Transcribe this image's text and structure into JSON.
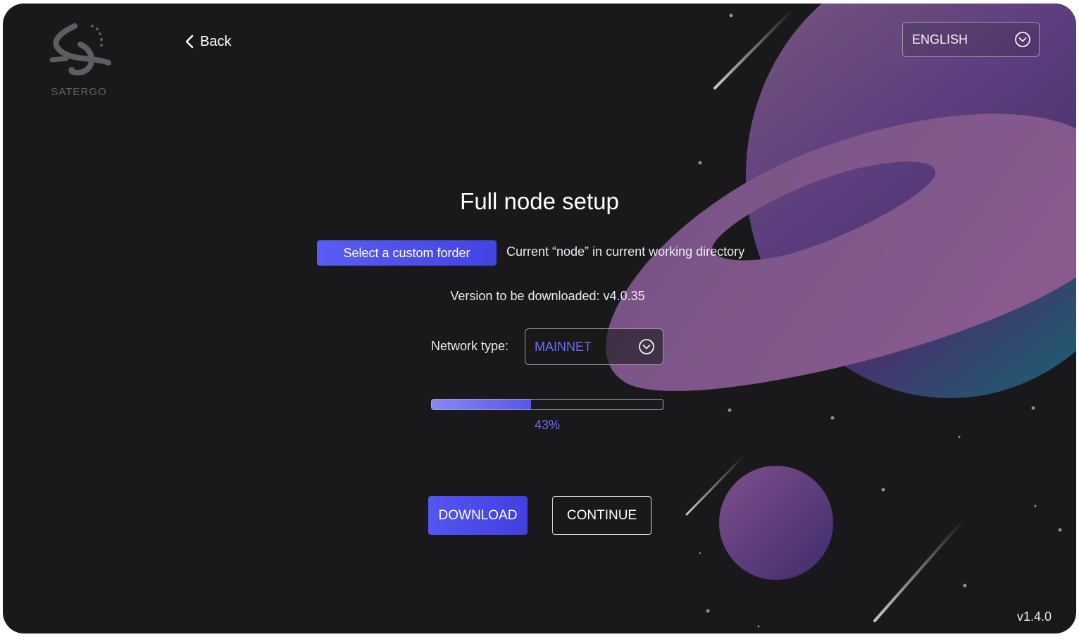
{
  "app": {
    "brand": "SATERGO",
    "version": "v1.4.0"
  },
  "nav": {
    "back_label": "Back"
  },
  "language": {
    "selected": "ENGLISH"
  },
  "setup": {
    "title": "Full node setup",
    "custom_folder_button": "Select a custom forder",
    "folder_path_text": "Current “node” in current working directory",
    "version_text": "Version to be downloaded: v4.0.35",
    "network_label": "Network type:",
    "network_selected": "MAINNET",
    "progress_value": 0.43,
    "progress_text": "43%",
    "download_label": "DOWNLOAD",
    "continue_label": "CONTINUE"
  },
  "colors": {
    "accent": "#5456f0",
    "accent_text": "#6a6cf4",
    "background": "#19191b",
    "planet": "#7a4f86"
  },
  "icons": {
    "back": "chevron-left-icon",
    "dropdown": "chevron-down-circle-icon",
    "logo": "satergo-logo-icon"
  }
}
